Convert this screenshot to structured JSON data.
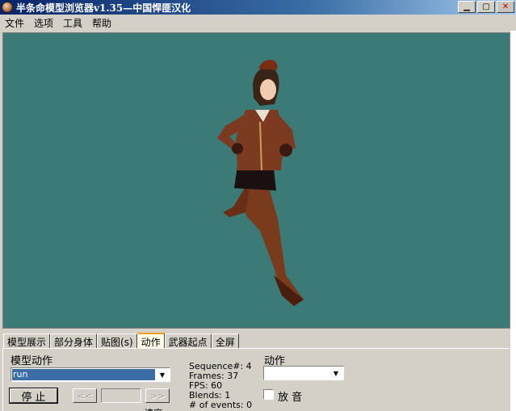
{
  "window": {
    "title": "半条命模型浏览器v1.35—中国悍匪汉化"
  },
  "menu": [
    "文件",
    "选项",
    "工具",
    "帮助"
  ],
  "colors": {
    "viewport_bg": "#3c7a78",
    "active_tab_accent": "#f0a020",
    "selection": "#3a6ea5"
  },
  "tabs": [
    {
      "label": "模型展示"
    },
    {
      "label": "部分身体"
    },
    {
      "label": "贴图(s)"
    },
    {
      "label": "动作",
      "active": true
    },
    {
      "label": "武器起点"
    },
    {
      "label": "全屏"
    }
  ],
  "panel": {
    "sequence_label": "模型动作",
    "sequence_value": "run",
    "stop_button": "停 止",
    "prev_button": "<<",
    "next_button": ">>",
    "frame_value": "",
    "info": {
      "sequence": "Sequence#: 4",
      "frames": "Frames: 37",
      "fps": "FPS: 60",
      "blends": "Blends: 1",
      "events": "# of events: 0"
    },
    "partial_label_left": "",
    "partial_label_mid": "速度",
    "action_label": "动作",
    "action_value": "",
    "sound_checkbox": "放 音",
    "sound_checked": false
  }
}
